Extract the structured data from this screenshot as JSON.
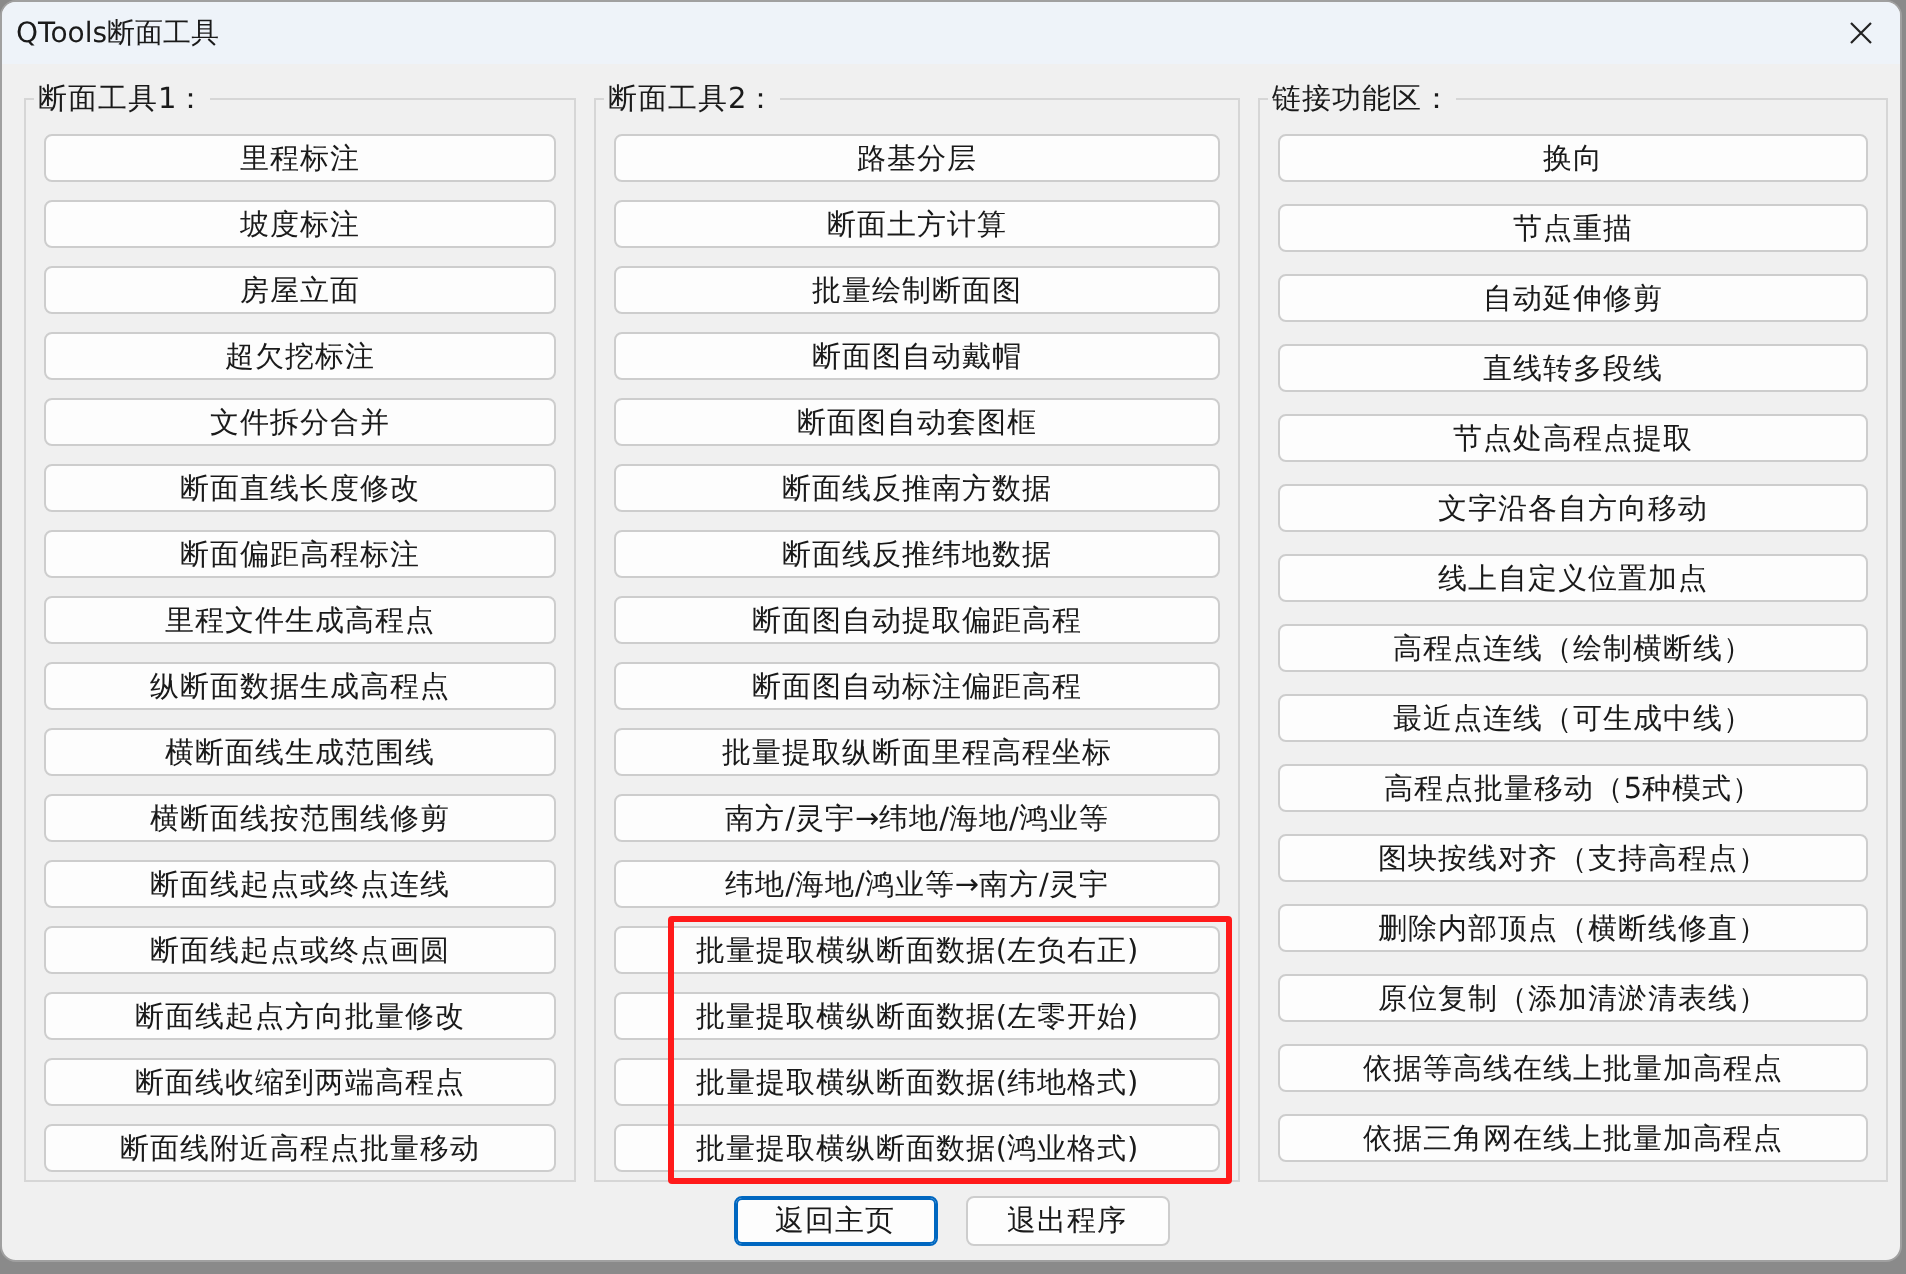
{
  "window": {
    "title": "QTools断面工具"
  },
  "sections": [
    {
      "title": "断面工具1：",
      "buttons": [
        {
          "label": "里程标注",
          "highlighted": false
        },
        {
          "label": "坡度标注",
          "highlighted": false
        },
        {
          "label": "房屋立面",
          "highlighted": false
        },
        {
          "label": "超欠挖标注",
          "highlighted": false
        },
        {
          "label": "文件拆分合并",
          "highlighted": false
        },
        {
          "label": "断面直线长度修改",
          "highlighted": false
        },
        {
          "label": "断面偏距高程标注",
          "highlighted": false
        },
        {
          "label": "里程文件生成高程点",
          "highlighted": false
        },
        {
          "label": "纵断面数据生成高程点",
          "highlighted": false
        },
        {
          "label": "横断面线生成范围线",
          "highlighted": false
        },
        {
          "label": "横断面线按范围线修剪",
          "highlighted": false
        },
        {
          "label": "断面线起点或终点连线",
          "highlighted": false
        },
        {
          "label": "断面线起点或终点画圆",
          "highlighted": false
        },
        {
          "label": "断面线起点方向批量修改",
          "highlighted": false
        },
        {
          "label": "断面线收缩到两端高程点",
          "highlighted": false
        },
        {
          "label": "断面线附近高程点批量移动",
          "highlighted": false
        }
      ]
    },
    {
      "title": "断面工具2：",
      "buttons": [
        {
          "label": "路基分层",
          "highlighted": false
        },
        {
          "label": "断面土方计算",
          "highlighted": false
        },
        {
          "label": "批量绘制断面图",
          "highlighted": false
        },
        {
          "label": "断面图自动戴帽",
          "highlighted": false
        },
        {
          "label": "断面图自动套图框",
          "highlighted": false
        },
        {
          "label": "断面线反推南方数据",
          "highlighted": false
        },
        {
          "label": "断面线反推纬地数据",
          "highlighted": false
        },
        {
          "label": "断面图自动提取偏距高程",
          "highlighted": false
        },
        {
          "label": "断面图自动标注偏距高程",
          "highlighted": false
        },
        {
          "label": "批量提取纵断面里程高程坐标",
          "highlighted": false
        },
        {
          "label": "南方/灵宇→纬地/海地/鸿业等",
          "highlighted": false
        },
        {
          "label": "纬地/海地/鸿业等→南方/灵宇",
          "highlighted": false
        },
        {
          "label": "批量提取横纵断面数据(左负右正)",
          "highlighted": true
        },
        {
          "label": "批量提取横纵断面数据(左零开始)",
          "highlighted": true
        },
        {
          "label": "批量提取横纵断面数据(纬地格式)",
          "highlighted": true
        },
        {
          "label": "批量提取横纵断面数据(鸿业格式)",
          "highlighted": true
        }
      ]
    },
    {
      "title": "链接功能区：",
      "buttons": [
        {
          "label": "换向",
          "highlighted": false
        },
        {
          "label": "节点重描",
          "highlighted": false
        },
        {
          "label": "自动延伸修剪",
          "highlighted": false
        },
        {
          "label": "直线转多段线",
          "highlighted": false
        },
        {
          "label": "节点处高程点提取",
          "highlighted": false
        },
        {
          "label": "文字沿各自方向移动",
          "highlighted": false
        },
        {
          "label": "线上自定义位置加点",
          "highlighted": false
        },
        {
          "label": "高程点连线（绘制横断线）",
          "highlighted": false
        },
        {
          "label": "最近点连线（可生成中线）",
          "highlighted": false
        },
        {
          "label": "高程点批量移动（5种模式）",
          "highlighted": false
        },
        {
          "label": "图块按线对齐（支持高程点）",
          "highlighted": false
        },
        {
          "label": "删除内部顶点（横断线修直）",
          "highlighted": false
        },
        {
          "label": "原位复制（添加清淤清表线）",
          "highlighted": false
        },
        {
          "label": "依据等高线在线上批量加高程点",
          "highlighted": false
        },
        {
          "label": "依据三角网在线上批量加高程点",
          "highlighted": false
        }
      ]
    }
  ],
  "footer_buttons": [
    {
      "label": "返回主页",
      "focused": true
    },
    {
      "label": "退出程序",
      "focused": false
    }
  ]
}
